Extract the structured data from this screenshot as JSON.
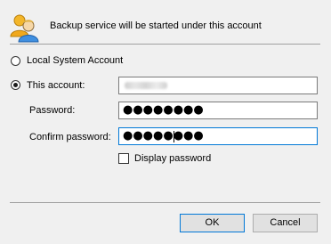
{
  "header": {
    "icon": "users-icon",
    "text": "Backup service will be started under this account"
  },
  "account_options": {
    "local_system_label": "Local System Account",
    "local_system_selected": false,
    "this_account_label": "This account:",
    "this_account_selected": true
  },
  "fields": {
    "password_label": "Password:",
    "password_value": "●●●●●●●●",
    "confirm_label": "Confirm password:",
    "confirm_value": "●●●●●●●●"
  },
  "display_password": {
    "label": "Display password",
    "checked": false
  },
  "buttons": {
    "ok_label": "OK",
    "cancel_label": "Cancel"
  },
  "colors": {
    "focus_border": "#0078d7",
    "background": "#f0f0f0"
  }
}
